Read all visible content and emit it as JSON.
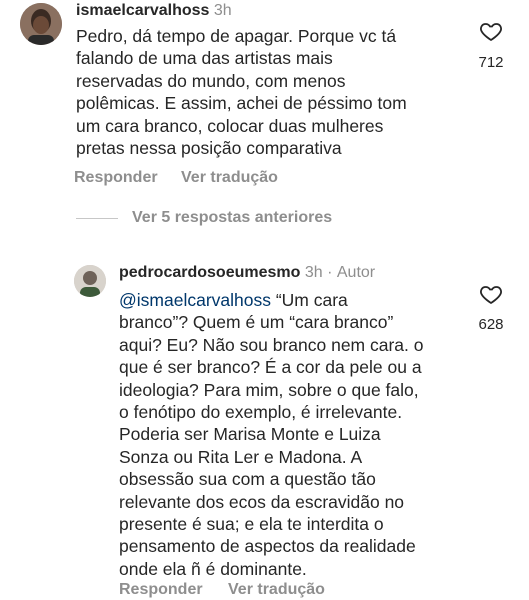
{
  "comment1": {
    "username": "ismaelcarvalhoss",
    "time": "3h",
    "lines": [
      "Pedro, dá tempo de apagar. Porque vc tá",
      "falando de uma das artistas mais",
      "reservadas do mundo, com menos",
      "polêmicas. E assim, achei de péssimo tom",
      "um cara branco, colocar duas mulheres",
      "pretas nessa posição comparativa"
    ],
    "likes": "712",
    "reply_label": "Responder",
    "translate_label": "Ver tradução"
  },
  "thread": {
    "view_replies_label": "Ver 5 respostas anteriores"
  },
  "comment2": {
    "username": "pedrocardosoeumesmo",
    "time": "3h",
    "separator": "·",
    "author_badge": "Autor",
    "mention": "@ismaelcarvalhoss",
    "first_line_rest": " “Um cara",
    "lines": [
      "branco”? Quem é um “cara branco”",
      "aqui? Eu? Não sou branco nem cara. o",
      "que é ser branco? É a cor da pele ou a",
      "ideologia? Para mim, sobre o que falo,",
      "o fenótipo do exemplo, é irrelevante.",
      "Poderia ser Marisa Monte e Luiza",
      "Sonza ou Rita Ler e Madona. A",
      "obsessão sua com a questão tão",
      "relevante dos ecos da escravidão no",
      "presente é sua; e ela te interdita o",
      "pensamento de aspectos da realidade",
      "onde ela ñ é dominante."
    ],
    "likes": "628",
    "reply_label": "Responder",
    "translate_label": "Ver tradução"
  },
  "icons": {
    "like": "heart-outline-icon",
    "avatar1": "avatar-photo",
    "avatar2": "avatar-photo"
  }
}
